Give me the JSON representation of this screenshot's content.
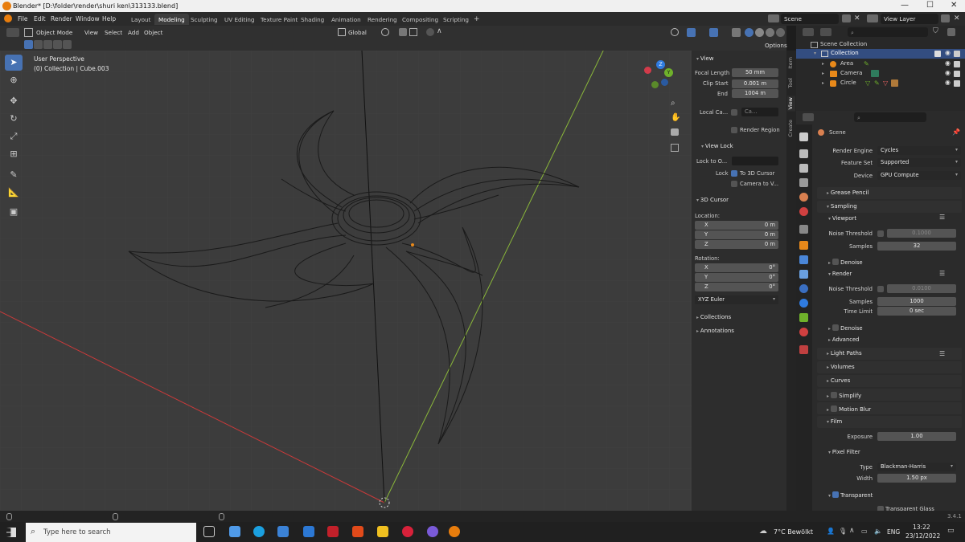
{
  "window": {
    "title": "Blender* [D:\\folder\\render\\shuri ken\\313133.blend]",
    "controls": [
      "—",
      "☐",
      "✕"
    ]
  },
  "menubar": {
    "menus": [
      "File",
      "Edit",
      "Render",
      "Window",
      "Help"
    ],
    "workspaces": [
      "Layout",
      "Modeling",
      "Sculpting",
      "UV Editing",
      "Texture Paint",
      "Shading",
      "Animation",
      "Rendering",
      "Compositing",
      "Scripting"
    ],
    "active_workspace": "Modeling",
    "add_tab": "+",
    "scene": "Scene",
    "view_layer": "View Layer"
  },
  "viewport_header": {
    "mode": "Object Mode",
    "menus": [
      "View",
      "Select",
      "Add",
      "Object"
    ],
    "orientation": "Global",
    "options": "Options"
  },
  "viewport": {
    "perspective": "User Perspective",
    "collection_info": "(0) Collection | Cube.003",
    "gizmo": {
      "x": "X",
      "y": "Y",
      "z": "Z"
    }
  },
  "npanel": {
    "tabs": [
      "Item",
      "Tool",
      "View",
      "Create"
    ],
    "active_tab": "View",
    "view": {
      "header": "View",
      "focal_length_label": "Focal Length",
      "focal_length": "50 mm",
      "clip_start_label": "Clip Start",
      "clip_start": "0.001 m",
      "end_label": "End",
      "end": "1004 m",
      "local_camera_label": "Local Ca...",
      "local_camera": "Ca...",
      "render_region": "Render Region"
    },
    "view_lock": {
      "header": "View Lock",
      "lock_to_label": "Lock to O...",
      "lock_label": "Lock",
      "to_3d_cursor": "To 3D Cursor",
      "camera_to_view": "Camera to V..."
    },
    "cursor": {
      "header": "3D Cursor",
      "location_label": "Location:",
      "location": [
        {
          "axis": "X",
          "value": "0 m"
        },
        {
          "axis": "Y",
          "value": "0 m"
        },
        {
          "axis": "Z",
          "value": "0 m"
        }
      ],
      "rotation_label": "Rotation:",
      "rotation": [
        {
          "axis": "X",
          "value": "0°"
        },
        {
          "axis": "Y",
          "value": "0°"
        },
        {
          "axis": "Z",
          "value": "0°"
        }
      ],
      "rotation_mode": "XYZ Euler"
    },
    "collections": "Collections",
    "annotations": "Annotations"
  },
  "outliner": {
    "root": "Scene Collection",
    "collection": "Collection",
    "items": [
      "Area",
      "Camera",
      "Circle"
    ]
  },
  "properties": {
    "context": "Scene",
    "render_engine_label": "Render Engine",
    "render_engine": "Cycles",
    "feature_set_label": "Feature Set",
    "feature_set": "Supported",
    "device_label": "Device",
    "device": "GPU Compute",
    "grease_pencil": "Grease Pencil",
    "sampling": "Sampling",
    "viewport": "Viewport",
    "noise_threshold_label": "Noise Threshold",
    "viewport_noise_threshold": "0.1000",
    "samples_label": "Samples",
    "viewport_samples": "32",
    "denoise": "Denoise",
    "render": "Render",
    "render_noise_threshold": "0.0100",
    "render_samples": "1000",
    "time_limit_label": "Time Limit",
    "time_limit": "0 sec",
    "advanced": "Advanced",
    "light_paths": "Light Paths",
    "volumes": "Volumes",
    "curves": "Curves",
    "simplify": "Simplify",
    "motion_blur": "Motion Blur",
    "film": "Film",
    "exposure_label": "Exposure",
    "exposure": "1.00",
    "pixel_filter": "Pixel Filter",
    "type_label": "Type",
    "type": "Blackman-Harris",
    "width_label": "Width",
    "width": "1.50 px",
    "transparent": "Transparent",
    "transparent_glass": "Transparent Glass"
  },
  "statusbar": {
    "version": "3.4.1"
  },
  "taskbar": {
    "search_placeholder": "Type here to search",
    "weather": "7°C  Bewölkt",
    "language": "ENG",
    "time": "13:22",
    "date": "23/12/2022"
  },
  "colors": {
    "accent": "#4772b3",
    "viewport_bg": "#3c3c3c",
    "x_axis": "#c93a3a",
    "y_axis": "#8ab73a",
    "blender_orange": "#e87d0d"
  }
}
